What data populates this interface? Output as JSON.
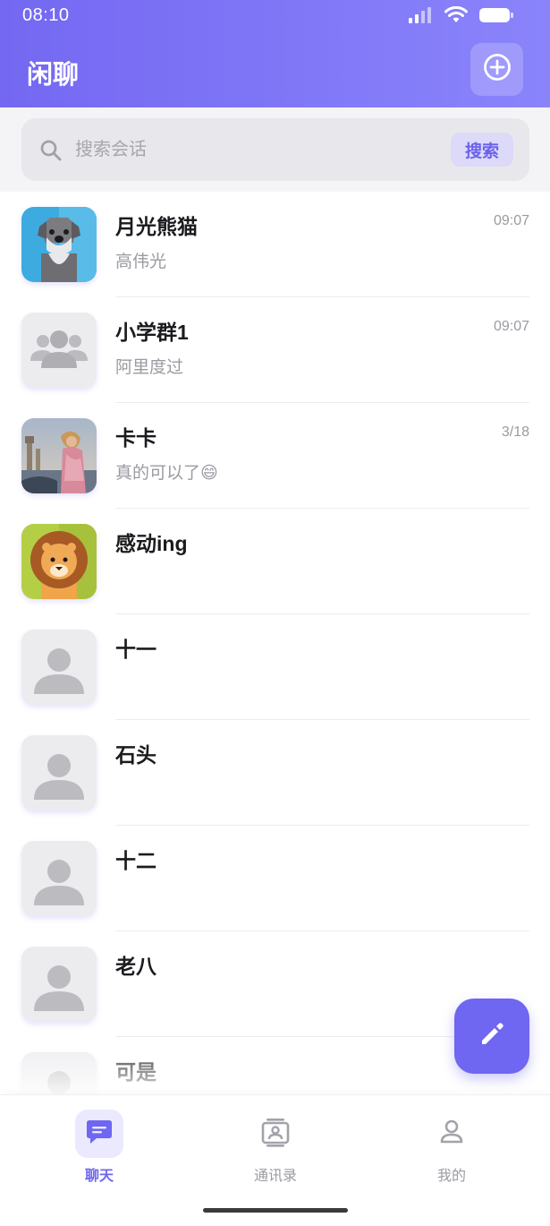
{
  "status_bar": {
    "time": "08:10"
  },
  "header": {
    "title": "闲聊"
  },
  "search": {
    "placeholder": "搜索会话",
    "button_label": "搜索"
  },
  "chats": [
    {
      "name": "月光熊猫",
      "preview": "高伟光",
      "time": "09:07",
      "avatar_icon": "schnauzer-avatar"
    },
    {
      "name": "小学群1",
      "preview": "阿里度过",
      "time": "09:07",
      "avatar_icon": "group-avatar"
    },
    {
      "name": "卡卡",
      "preview": "真的可以了😄",
      "time": "3/18",
      "avatar_icon": "photo-avatar"
    },
    {
      "name": "感动ing",
      "preview": "",
      "time": "",
      "avatar_icon": "lion-avatar"
    },
    {
      "name": "十一",
      "preview": "",
      "time": "",
      "avatar_icon": "person-avatar"
    },
    {
      "name": "石头",
      "preview": "",
      "time": "",
      "avatar_icon": "person-avatar"
    },
    {
      "name": "十二",
      "preview": "",
      "time": "",
      "avatar_icon": "person-avatar"
    },
    {
      "name": "老八",
      "preview": "",
      "time": "",
      "avatar_icon": "person-avatar"
    },
    {
      "name": "可是",
      "preview": "",
      "time": "",
      "avatar_icon": "person-avatar"
    }
  ],
  "bottom_nav": [
    {
      "label": "聊天",
      "icon": "chat-icon",
      "active": true
    },
    {
      "label": "通讯录",
      "icon": "contacts-icon",
      "active": false
    },
    {
      "label": "我的",
      "icon": "profile-icon",
      "active": false
    }
  ],
  "colors": {
    "accent": "#6f66f1",
    "header_start": "#7468f2",
    "header_end": "#8a84fb"
  }
}
